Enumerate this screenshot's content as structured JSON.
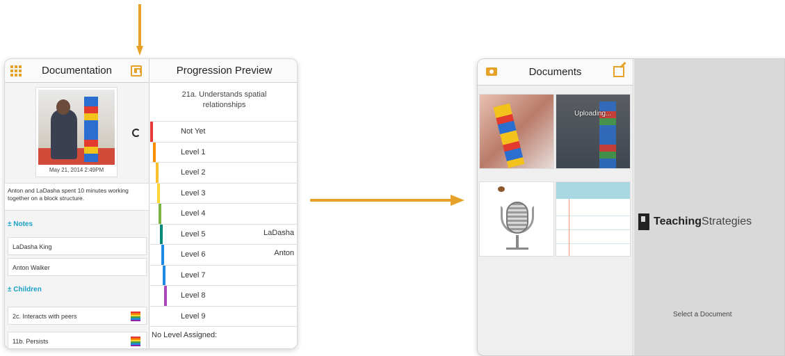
{
  "colors": {
    "accent": "#e6a228",
    "link": "#1aa0c8"
  },
  "left_panel": {
    "documentation_title": "Documentation",
    "photo_date": "May 21, 2014 2:49PM",
    "description": "Anton and LaDasha spent 10 minutes working together on a block structure.",
    "notes_label": "± Notes",
    "notes": [
      "LaDasha King",
      "Anton Walker"
    ],
    "children_label": "± Children",
    "objectives": [
      "2c. Interacts with peers",
      "11b. Persists"
    ],
    "progression_title": "Progression Preview",
    "objective_title": "21a. Understands spatial relationships",
    "levels": [
      {
        "label": "Not Yet",
        "color": "#e53935",
        "child": ""
      },
      {
        "label": "Level 1",
        "color": "#fb8c00",
        "child": ""
      },
      {
        "label": "Level 2",
        "color": "#fbc02d",
        "child": ""
      },
      {
        "label": "Level 3",
        "color": "#fdd835",
        "child": ""
      },
      {
        "label": "Level 4",
        "color": "#7cb342",
        "child": ""
      },
      {
        "label": "Level 5",
        "color": "#00897b",
        "child": "LaDasha"
      },
      {
        "label": "Level 6",
        "color": "#1e88e5",
        "child": "Anton"
      },
      {
        "label": "Level 7",
        "color": "#1e88e5",
        "child": ""
      },
      {
        "label": "Level 8",
        "color": "#ab47bc",
        "child": ""
      },
      {
        "label": "Level 9",
        "color": "",
        "child": ""
      }
    ],
    "no_level": "No Level Assigned:"
  },
  "right_panel": {
    "documents_title": "Documents",
    "uploading": "Uploading...",
    "brand_bold": "Teaching",
    "brand_light": "Strategies",
    "select_document": "Select a Document"
  }
}
